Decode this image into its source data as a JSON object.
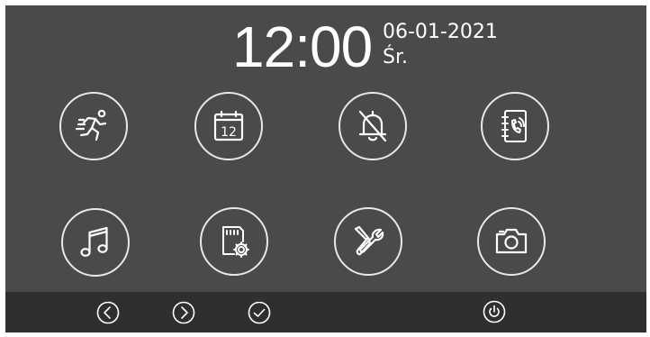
{
  "header": {
    "time": "12:00",
    "date": "06-01-2021",
    "weekday": "Śr."
  },
  "menu": [
    {
      "name": "motion-detection",
      "icon": "running-person-icon"
    },
    {
      "name": "calendar",
      "icon": "calendar-icon",
      "icon_text": "12"
    },
    {
      "name": "do-not-disturb",
      "icon": "bell-off-icon"
    },
    {
      "name": "intercom-phonebook",
      "icon": "phonebook-icon"
    },
    {
      "name": "ringtone",
      "icon": "music-note-icon"
    },
    {
      "name": "memory-card-settings",
      "icon": "sd-card-settings-icon"
    },
    {
      "name": "tools-settings",
      "icon": "wrench-screwdriver-icon"
    },
    {
      "name": "snapshot",
      "icon": "camera-icon"
    }
  ],
  "bottom_bar": {
    "buttons": [
      {
        "name": "previous",
        "icon": "chevron-left-icon"
      },
      {
        "name": "next",
        "icon": "chevron-right-icon"
      },
      {
        "name": "confirm",
        "icon": "checkmark-icon"
      },
      {
        "name": "power",
        "icon": "power-icon"
      }
    ]
  },
  "colors": {
    "screen_background": "#4a4a4a",
    "bottom_bar_background": "#2f2f2f",
    "foreground": "#ffffff"
  }
}
